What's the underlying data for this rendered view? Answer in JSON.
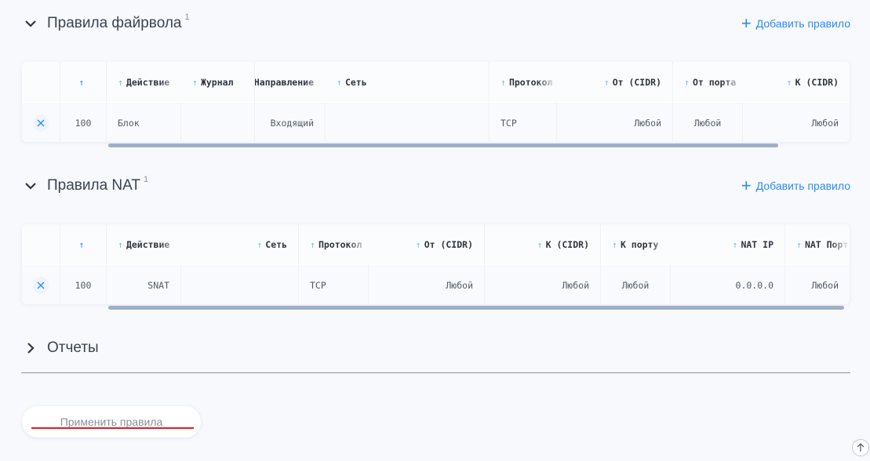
{
  "firewall": {
    "title": "Правила файрвола",
    "count": "1",
    "add_label": "Добавить правило",
    "columns": [
      "",
      "",
      "Действие",
      "Журнал",
      "Направление",
      "Сеть",
      "Протокол",
      "От (CIDR)",
      "От порта",
      "К (CIDR)"
    ],
    "row": {
      "priority": "100",
      "action": "Блок",
      "log": "",
      "direction": "Входящий",
      "network": "",
      "protocol": "TCP",
      "from_cidr": "Любой",
      "from_port": "Любой",
      "to_cidr": "Любой"
    }
  },
  "nat": {
    "title": "Правила NAT",
    "count": "1",
    "add_label": "Добавить правило",
    "columns": [
      "",
      "",
      "Действие",
      "Сеть",
      "Протокол",
      "От (CIDR)",
      "К (CIDR)",
      "К порту",
      "NAT IP",
      "NAT Порт"
    ],
    "row": {
      "priority": "100",
      "action": "SNAT",
      "network": "",
      "protocol": "TCP",
      "from_cidr": "Любой",
      "to_cidr": "Любой",
      "to_port": "Любой",
      "nat_ip": "0.0.0.0",
      "nat_port": "Любой"
    }
  },
  "reports": {
    "title": "Отчеты"
  },
  "apply_button": {
    "label": "Применить правила"
  },
  "colors": {
    "accent": "#2d8cf0",
    "underline": "#e01b24",
    "scrollbar": "#9fb0c6"
  },
  "icons": {
    "collapse": "chevron-down-icon",
    "expand": "chevron-right-icon",
    "add": "plus-icon",
    "delete": "close-icon",
    "sort": "arrow-up-icon",
    "scroll_top": "arrow-up-icon"
  }
}
